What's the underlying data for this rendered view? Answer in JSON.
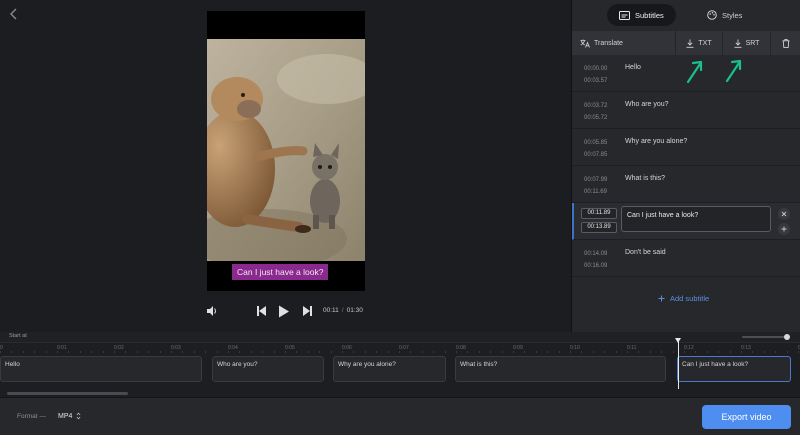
{
  "colors": {
    "accent": "#4d8ef0",
    "caption_bg": "#8a2a8f",
    "annotation_arrow": "#19c08c"
  },
  "preview": {
    "caption": "Can I just have a look?",
    "current_time": "00:11",
    "time_separator": "/",
    "total_time": "01:30"
  },
  "panel": {
    "tabs": [
      {
        "label": "Subtitles",
        "icon": "subtitles-icon",
        "active": true
      },
      {
        "label": "Styles",
        "icon": "palette-icon",
        "active": false
      }
    ],
    "toolbar": {
      "translate_label": "Translate",
      "txt_label": "TXT",
      "srt_label": "SRT"
    },
    "subtitles": [
      {
        "start": "00:00.00",
        "end": "00:03.57",
        "text": "Hello"
      },
      {
        "start": "00:03.72",
        "end": "00:05.72",
        "text": "Who are you?"
      },
      {
        "start": "00:05.85",
        "end": "00:07.85",
        "text": "Why are you alone?"
      },
      {
        "start": "00:07.99",
        "end": "00:11.69",
        "text": "What is this?"
      },
      {
        "start": "00:11.89",
        "end": "00:13.89",
        "text": "Can I just have a look?",
        "active": true
      },
      {
        "start": "00:14.09",
        "end": "00:16.09",
        "text": "Don't be said"
      }
    ],
    "add_subtitle_label": "Add subtitle"
  },
  "timeline": {
    "start_label": "Start at",
    "ticks": [
      "0",
      "0:01",
      "0:02",
      "0:03",
      "0:04",
      "0:05",
      "0:06",
      "0:07",
      "0:08",
      "0:09",
      "0:10",
      "0:11",
      "0:12",
      "0:13",
      "0:14"
    ],
    "clips": [
      "Hello",
      "Who are you?",
      "Why are you alone?",
      "What is this?",
      "Can I just have a look?"
    ]
  },
  "footer": {
    "format_label": "Format —",
    "format_value": "MP4",
    "export_label": "Export video"
  }
}
